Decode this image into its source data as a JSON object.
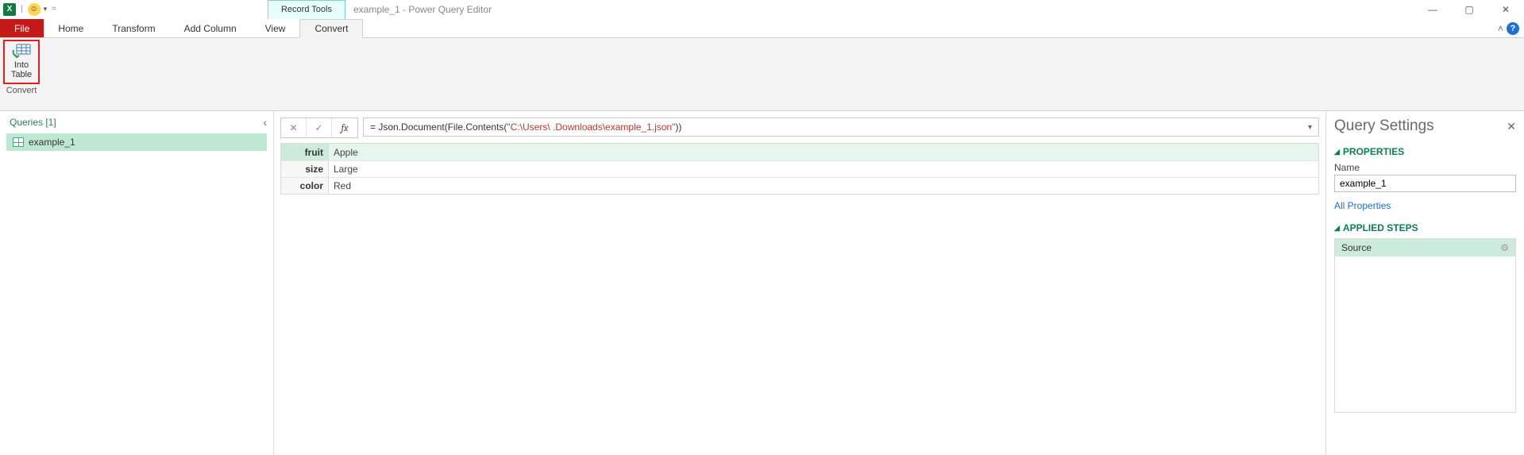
{
  "title_bar": {
    "contextual_tab": "Record Tools",
    "window_title": "example_1 - Power Query Editor",
    "qat_divider": "|",
    "qat_eq": "="
  },
  "tabs": {
    "file": "File",
    "home": "Home",
    "transform": "Transform",
    "add_column": "Add Column",
    "view": "View",
    "convert": "Convert"
  },
  "ribbon": {
    "into_table_line1": "Into",
    "into_table_line2": "Table",
    "group_convert": "Convert"
  },
  "queries": {
    "header": "Queries [1]",
    "items": [
      {
        "name": "example_1"
      }
    ]
  },
  "formula": {
    "fx_label": "fx",
    "prefix": "= Json.Document(File.Contents(",
    "str1": "\"C:\\Users\\",
    "str_gap": "         ",
    "str2": ".Downloads\\example_1.json\"",
    "suffix": "))"
  },
  "record": {
    "rows": [
      {
        "key": "fruit",
        "value": "Apple"
      },
      {
        "key": "size",
        "value": "Large"
      },
      {
        "key": "color",
        "value": "Red"
      }
    ]
  },
  "settings": {
    "title": "Query Settings",
    "properties_header": "PROPERTIES",
    "name_label": "Name",
    "name_value": "example_1",
    "all_properties": "All Properties",
    "applied_steps_header": "APPLIED STEPS",
    "steps": [
      {
        "name": "Source"
      }
    ]
  },
  "glyphs": {
    "excel": "X",
    "face": "☺",
    "caret": "▾",
    "min": "—",
    "max": "▢",
    "close": "✕",
    "collapse": "˄",
    "help": "?",
    "chev_left": "‹",
    "cancel": "✕",
    "commit": "✓",
    "tri": "◢",
    "gear": "⚙"
  }
}
